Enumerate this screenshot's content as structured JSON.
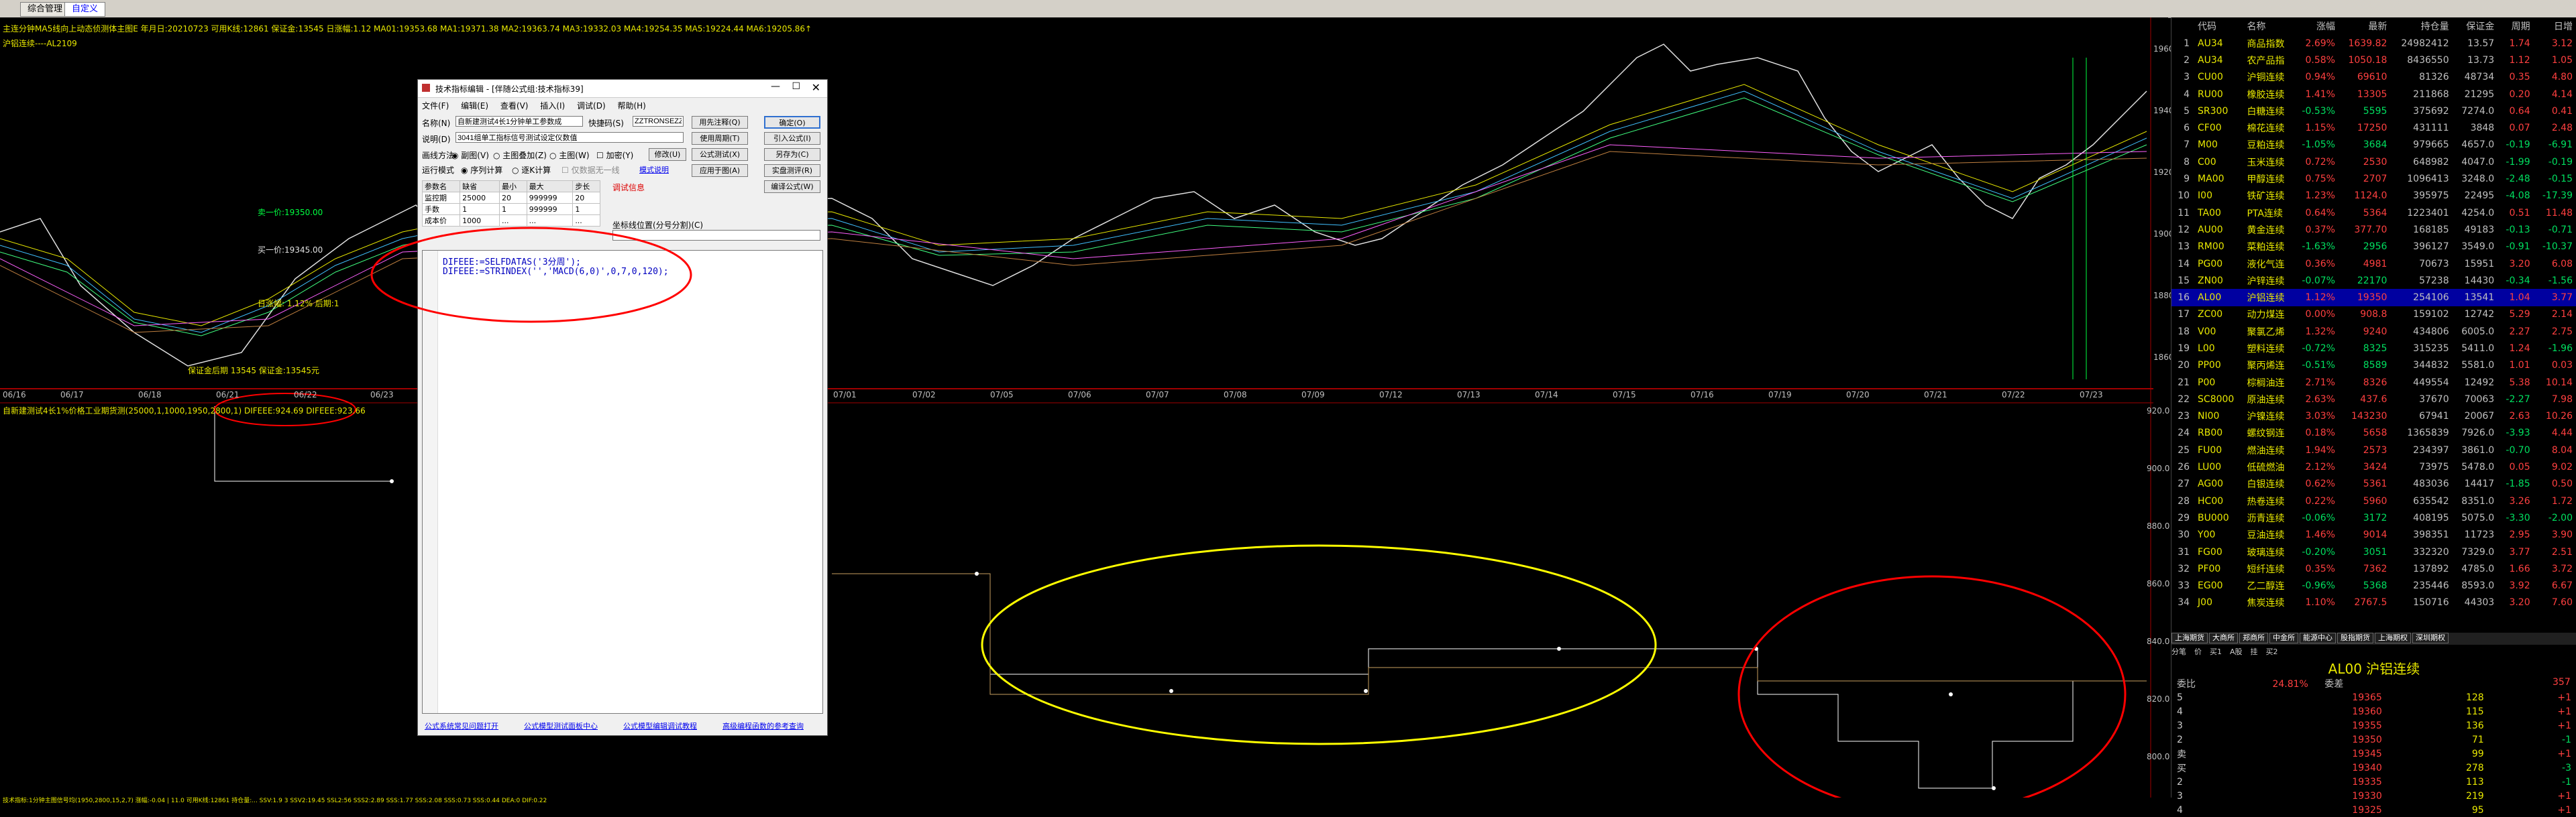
{
  "tabs": [
    "综合管理",
    "自定义"
  ],
  "chart": {
    "title_line": "主连分钟MA5线向上动态侦测体主图E 年月日:20210723 可用K线:12861 保证金:13545 日涨幅:1.12 MA01:19353.68 MA1:19371.38 MA2:19363.74 MA3:19332.03 MA4:19254.35 MA5:19224.44 MA6:19205.86↑",
    "sub_title": "沪铝连续----AL2109",
    "price_labels": [
      "19600",
      "19400",
      "19200",
      "19000",
      "18800",
      "18600",
      "18400"
    ],
    "annotations": {
      "sell1": "卖一价:19350.00",
      "buy1": "买一价:19345.00",
      "daily_change": "日涨幅: 1.12% 后期:1",
      "bottom_note": "保证金后期 13545 保证金:13545元"
    },
    "dates": [
      "06/16",
      "06/17",
      "06/18",
      "06/21",
      "06/22",
      "06/23",
      "07/01",
      "07/02",
      "07/05",
      "07/06",
      "07/07",
      "07/08",
      "07/09",
      "07/12",
      "07/13",
      "07/14",
      "07/15",
      "07/16",
      "07/19",
      "07/20",
      "07/21",
      "07/22",
      "07/23"
    ],
    "sub_header": "自新建测试4长1%价格工业期货测(25000,1,1000,1950,2800,1) DIFEEE:924.69 DIFEEE:923.66",
    "sub_labels": [
      "920.0",
      "900.0",
      "880.0",
      "860.0",
      "840.0",
      "820.0",
      "800.0"
    ],
    "bottom_status": "技术指标:1分钟主图信号均(1950,2800,15,2,7) 涨幅:-0.04 | 11.0 可用K线:12861 持仓量:... SSV:1.9 3 SSV2:19.45 SSL2:56 SSS2:2.89 SSS:1.77 SSS:2.08 SSS:0.73 SSS:0.44 DEA:0 DIF:0.22"
  },
  "dialog": {
    "title": "技术指标编辑 - [伴随公式组:技术指标39]",
    "menu": [
      "文件(F)",
      "编辑(E)",
      "查看(V)",
      "插入(I)",
      "调试(D)",
      "帮助(H)"
    ],
    "name_label": "名称(N)",
    "name_value": "自新建测试4长1分钟单工参数成",
    "pwd_label": "快捷码(S)",
    "pwd_value": "ZZTRONSEZZ",
    "desc_label": "说明(D)",
    "desc_value": "3041组单工指标信号测试设定仪数值",
    "type_label": "画线方法",
    "radio": [
      "副图(V)",
      "主图叠加(Z)",
      "主图(W)"
    ],
    "lock_label": "加密(Y)",
    "run_label": "运行模式",
    "run_radio": [
      "序列计算",
      "逐K计算"
    ],
    "run_extra": "仅数据无一线",
    "run_link": "模式说明",
    "buttons_left": [
      "用先注释(Q)",
      "使用周期(T)",
      "公式测试(X)",
      "应用于图(A)"
    ],
    "buttons_right": [
      "确定(O)",
      "引入公式(I)",
      "另存为(C)",
      "实盘测评(R)",
      "编译公式(W)"
    ],
    "sub_btn": "修改(U)",
    "param_headers": [
      "参数名",
      "缺省",
      "最小",
      "最大",
      "步长"
    ],
    "params": [
      [
        "监控期",
        "25000",
        "20",
        "999999",
        "20"
      ],
      [
        "手数",
        "1",
        "1",
        "999999",
        "1"
      ],
      [
        "成本价",
        "1000",
        "...",
        "...",
        "..."
      ]
    ],
    "func_label": "调试信息",
    "line_label": "坐标线位置(分号分割)(C)",
    "code": [
      "DIFEEE:=SELFDATAS('3分周');",
      "DIFEEE:=STRINDEX('','MACD(6,0)',0,7,0,120);"
    ],
    "links": [
      "公式系统常见问题打开",
      "公式模型测试面板中心",
      "公式模型编辑调试教程",
      "高级编程函数的参考查询"
    ]
  },
  "panel": {
    "headers": [
      "",
      "代码",
      "名称",
      "涨幅",
      "最新",
      "持仓量",
      "保证金",
      "周期",
      "日增"
    ],
    "rows": [
      [
        "1",
        "AU34",
        "商品指数",
        "2.69%",
        "1639.82",
        "24982412",
        "13.57",
        "1.74",
        "3.12"
      ],
      [
        "2",
        "AU34",
        "农产品指",
        "0.58%",
        "1050.18",
        "8436550",
        "13.73",
        "1.12",
        "1.05"
      ],
      [
        "3",
        "CU00",
        "沪铜连续",
        "0.94%",
        "69610",
        "81326",
        "48734",
        "0.35",
        "4.80"
      ],
      [
        "4",
        "RU00",
        "橡胶连续",
        "1.41%",
        "13305",
        "211868",
        "21295",
        "0.20",
        "4.14"
      ],
      [
        "5",
        "SR300",
        "白糖连续",
        "-0.53%",
        "5595",
        "375692",
        "7274.0",
        "0.64",
        "0.41"
      ],
      [
        "6",
        "CF00",
        "棉花连续",
        "1.15%",
        "17250",
        "431111",
        "3848",
        "0.07",
        "2.48"
      ],
      [
        "7",
        "M00",
        "豆粕连续",
        "-1.05%",
        "3684",
        "979665",
        "4657.0",
        "-0.19",
        "-6.91"
      ],
      [
        "8",
        "C00",
        "玉米连续",
        "0.72%",
        "2530",
        "648982",
        "4047.0",
        "-1.99",
        "-0.19"
      ],
      [
        "9",
        "MA00",
        "甲醇连续",
        "0.75%",
        "2707",
        "1096413",
        "3248.0",
        "-2.48",
        "-0.15"
      ],
      [
        "10",
        "I00",
        "铁矿连续",
        "1.23%",
        "1124.0",
        "395975",
        "22495",
        "-4.08",
        "-17.39"
      ],
      [
        "11",
        "TA00",
        "PTA连续",
        "0.64%",
        "5364",
        "1223401",
        "4254.0",
        "0.51",
        "11.48"
      ],
      [
        "12",
        "AU00",
        "黄金连续",
        "0.37%",
        "377.70",
        "168185",
        "49183",
        "-0.13",
        "-0.71"
      ],
      [
        "13",
        "RM00",
        "菜粕连续",
        "-1.63%",
        "2956",
        "396127",
        "3549.0",
        "-0.91",
        "-10.37"
      ],
      [
        "14",
        "PG00",
        "液化气连",
        "0.36%",
        "4981",
        "70673",
        "15951",
        "3.20",
        "6.08"
      ],
      [
        "15",
        "ZN00",
        "沪锌连续",
        "-0.07%",
        "22170",
        "57238",
        "14430",
        "-0.34",
        "-1.56"
      ],
      [
        "16",
        "AL00",
        "沪铝连续",
        "1.12%",
        "19350",
        "254106",
        "13541",
        "1.04",
        "3.77"
      ],
      [
        "17",
        "ZC00",
        "动力煤连",
        "0.00%",
        "908.8",
        "159102",
        "12742",
        "5.29",
        "2.14"
      ],
      [
        "18",
        "V00",
        "聚氯乙烯",
        "1.32%",
        "9240",
        "434806",
        "6005.0",
        "2.27",
        "2.75"
      ],
      [
        "19",
        "L00",
        "塑料连续",
        "-0.72%",
        "8325",
        "315235",
        "5411.0",
        "1.24",
        "-1.96"
      ],
      [
        "20",
        "PP00",
        "聚丙烯连",
        "-0.51%",
        "8589",
        "344832",
        "5581.0",
        "1.01",
        "0.03"
      ],
      [
        "21",
        "P00",
        "棕榈油连",
        "2.71%",
        "8326",
        "449554",
        "12492",
        "5.38",
        "10.14"
      ],
      [
        "22",
        "SC8000",
        "原油连续",
        "2.63%",
        "437.6",
        "37670",
        "70063",
        "-2.27",
        "7.98"
      ],
      [
        "23",
        "NI00",
        "沪镍连续",
        "3.03%",
        "143230",
        "67941",
        "20067",
        "2.63",
        "10.26"
      ],
      [
        "24",
        "RB00",
        "螺纹钢连",
        "0.18%",
        "5658",
        "1365839",
        "7926.0",
        "-3.93",
        "4.44"
      ],
      [
        "25",
        "FU00",
        "燃油连续",
        "1.94%",
        "2573",
        "234397",
        "3861.0",
        "-0.70",
        "8.04"
      ],
      [
        "26",
        "LU00",
        "低硫燃油",
        "2.12%",
        "3424",
        "73975",
        "5478.0",
        "0.05",
        "9.02"
      ],
      [
        "27",
        "AG00",
        "白银连续",
        "0.62%",
        "5361",
        "483036",
        "14417",
        "-1.85",
        "0.50"
      ],
      [
        "28",
        "HC00",
        "热卷连续",
        "0.22%",
        "5960",
        "635542",
        "8351.0",
        "3.26",
        "1.72"
      ],
      [
        "29",
        "BU000",
        "沥青连续",
        "-0.06%",
        "3172",
        "408195",
        "5075.0",
        "-3.30",
        "-2.00"
      ],
      [
        "30",
        "Y00",
        "豆油连续",
        "1.46%",
        "9014",
        "398351",
        "11723",
        "2.95",
        "3.90"
      ],
      [
        "31",
        "FG00",
        "玻璃连续",
        "-0.20%",
        "3051",
        "332320",
        "7329.0",
        "3.77",
        "2.51"
      ],
      [
        "32",
        "PF00",
        "短纤连续",
        "0.35%",
        "7362",
        "137892",
        "4785.0",
        "1.66",
        "3.72"
      ],
      [
        "33",
        "EG00",
        "乙二醇连",
        "-0.96%",
        "5368",
        "235446",
        "8593.0",
        "3.92",
        "6.67"
      ],
      [
        "34",
        "J00",
        "焦炭连续",
        "1.10%",
        "2767.5",
        "150716",
        "44303",
        "3.20",
        "7.60"
      ]
    ],
    "selected": 15,
    "bottom_tabs": [
      "上海期货",
      "大商所",
      "郑商所",
      "中金所",
      "能源中心",
      "股指期货",
      "上海期权",
      "深圳期权"
    ],
    "info_tabs": [
      "分笔",
      "价",
      "买1",
      "A股",
      "挂",
      "买2"
    ],
    "book_title": "AL00 沪铝连续",
    "book_ratio_label": "委比",
    "book_ratio": "24.81%",
    "book_diff_label": "委差",
    "book_diff": "357",
    "asks": [
      [
        "5",
        "19365",
        "128",
        "+1"
      ],
      [
        "4",
        "19360",
        "115",
        "+1"
      ],
      [
        "3",
        "19355",
        "136",
        "+1"
      ],
      [
        "2",
        "19350",
        "71",
        "-1"
      ],
      [
        "卖",
        "19345",
        "99",
        "+1"
      ]
    ],
    "bids": [
      [
        "买",
        "19340",
        "278",
        "-3"
      ],
      [
        "2",
        "19335",
        "113",
        "-1"
      ],
      [
        "3",
        "19330",
        "219",
        "+1"
      ],
      [
        "4",
        "19325",
        "95",
        "+1"
      ]
    ]
  }
}
